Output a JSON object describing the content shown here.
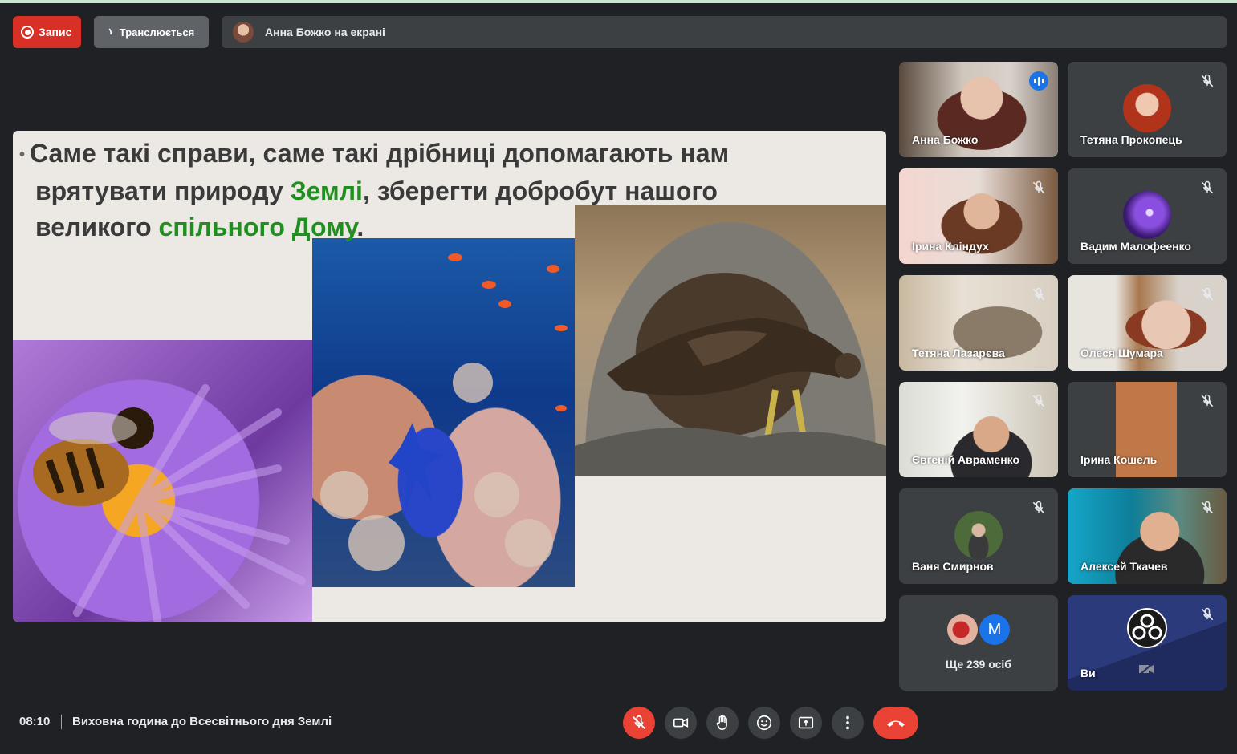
{
  "top_bar": {
    "record_label": "Запис",
    "stream_label": "Транслюється",
    "presenter_text": "Анна Божко на екрані"
  },
  "slide": {
    "line1": "Саме такі справи, саме такі дрібниці допомагають нам",
    "line2_before": "врятувати природу ",
    "line2_green": "Землі",
    "line2_after": ", зберегти добробут нашого",
    "line3_before": "великого ",
    "line3_green": "спільного Дому",
    "line3_after": "."
  },
  "participants": [
    {
      "name": "Анна Божко",
      "speaking": true
    },
    {
      "name": "Тетяна Прокопець",
      "muted": true
    },
    {
      "name": "Ірина Кліндух",
      "muted": true
    },
    {
      "name": "Вадим Малофеенко",
      "muted": true
    },
    {
      "name": "Тетяна Лазарєва",
      "muted": true
    },
    {
      "name": "Олеся Шумара",
      "muted": true
    },
    {
      "name": "Євгеній Авраменко",
      "muted": true
    },
    {
      "name": "Ірина Кошель",
      "muted": true
    },
    {
      "name": "Ваня Смирнов",
      "muted": true
    },
    {
      "name": "Алексей Ткачев",
      "muted": true
    }
  ],
  "more_people": {
    "avatar_letter": "M",
    "label": "Ще 239 осіб"
  },
  "self_tile": {
    "name": "Ви"
  },
  "bottom_bar": {
    "time": "08:10",
    "meeting_title": "Виховна година до Всесвітнього дня Землі"
  },
  "colors": {
    "background": "#202124",
    "record_red": "#d93025",
    "control_red": "#ea4335",
    "active_border": "#8ab4f8",
    "speaking_blue": "#1a73e8",
    "slide_green": "#1f8f1f"
  },
  "icons": [
    "record-icon",
    "broadcast-icon",
    "mic-off-icon",
    "camera-icon",
    "raise-hand-icon",
    "emoji-icon",
    "present-icon",
    "more-vert-icon",
    "hangup-icon",
    "audio-level-icon"
  ]
}
